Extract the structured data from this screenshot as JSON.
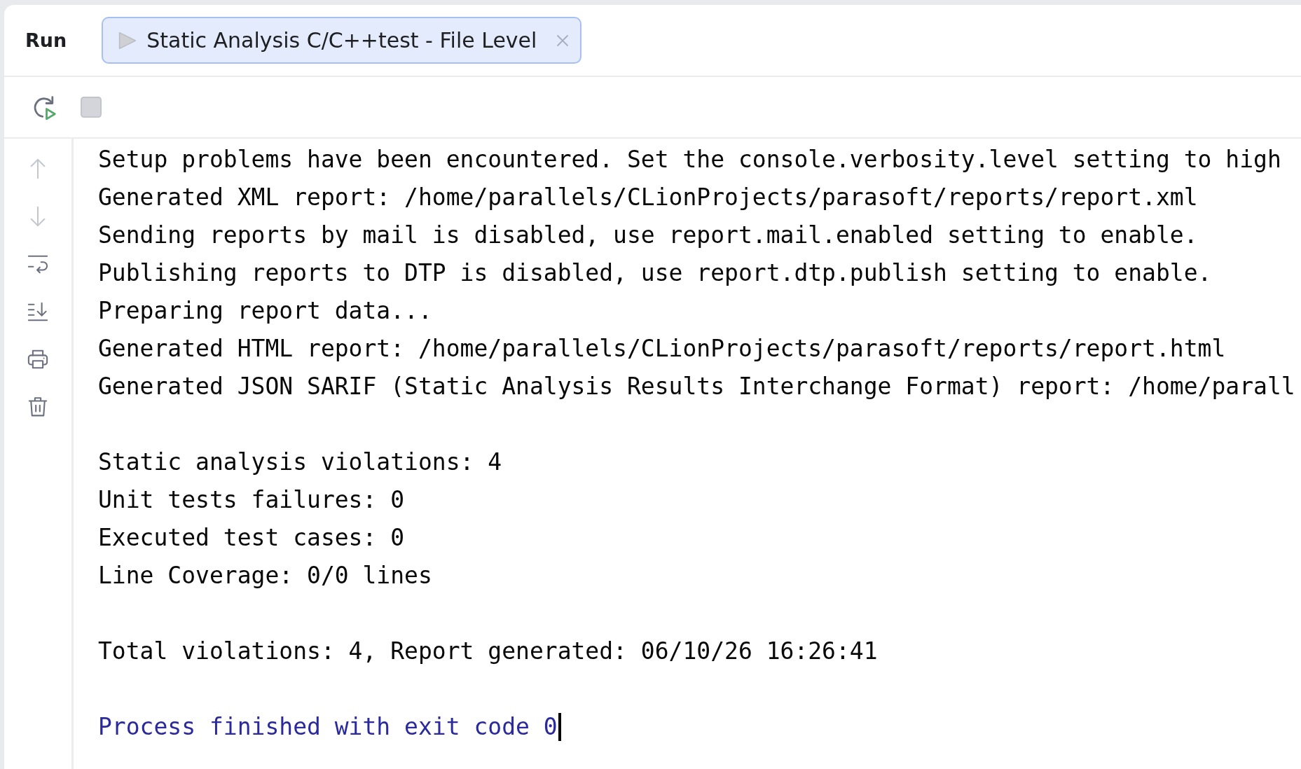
{
  "tool_window": {
    "title": "Run"
  },
  "tabs": [
    {
      "label": "Static Analysis C/C++test - File Level",
      "selected": true
    }
  ],
  "toolbar": [
    {
      "kind": "rerun",
      "disabled": false
    },
    {
      "kind": "stop",
      "disabled": true
    }
  ],
  "side_toolbar": [
    {
      "kind": "previous",
      "disabled": true
    },
    {
      "kind": "next",
      "disabled": true
    },
    {
      "kind": "soft_wrap",
      "disabled": false
    },
    {
      "kind": "scroll_to_end",
      "disabled": false
    },
    {
      "kind": "print",
      "disabled": false
    },
    {
      "kind": "clear",
      "disabled": false
    }
  ],
  "console": {
    "lines": [
      {
        "kind": "output",
        "text": "Setup problems have been encountered. Set the console.verbosity.level setting to high"
      },
      {
        "kind": "output",
        "text": "Generated XML report: /home/parallels/CLionProjects/parasoft/reports/report.xml"
      },
      {
        "kind": "output",
        "text": "Sending reports by mail is disabled, use report.mail.enabled setting to enable."
      },
      {
        "kind": "output",
        "text": "Publishing reports to DTP is disabled, use report.dtp.publish setting to enable."
      },
      {
        "kind": "output",
        "text": "Preparing report data..."
      },
      {
        "kind": "output",
        "text": "Generated HTML report: /home/parallels/CLionProjects/parasoft/reports/report.html"
      },
      {
        "kind": "output",
        "text": "Generated JSON SARIF (Static Analysis Results Interchange Format) report: /home/parall"
      },
      {
        "kind": "blank"
      },
      {
        "kind": "output",
        "text": "Static analysis violations: 4"
      },
      {
        "kind": "output",
        "text": "Unit tests failures: 0"
      },
      {
        "kind": "output",
        "text": "Executed test cases: 0"
      },
      {
        "kind": "output",
        "text": "Line Coverage: 0/0 lines"
      },
      {
        "kind": "blank"
      },
      {
        "kind": "output",
        "text": "Total violations: 4, Report generated: 06/10/26 16:26:41"
      },
      {
        "kind": "blank"
      },
      {
        "kind": "system",
        "text": "Process finished with exit code 0"
      }
    ],
    "caret": true
  }
}
